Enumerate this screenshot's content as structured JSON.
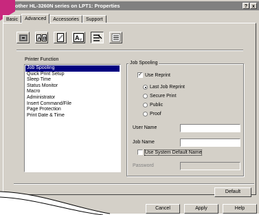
{
  "window": {
    "title": "other HL-3260N series on LPT1: Properties",
    "help_btn": "?",
    "close_btn": "x"
  },
  "tabs": [
    {
      "label": "Basic"
    },
    {
      "label": "Advanced"
    },
    {
      "label": "Accessories"
    },
    {
      "label": "Support"
    }
  ],
  "toolbar_icons": [
    {
      "name": "quality-icon"
    },
    {
      "name": "duplex-icon"
    },
    {
      "name": "watermark-icon"
    },
    {
      "name": "page-setting-icon"
    },
    {
      "name": "device-options-icon"
    },
    {
      "name": "settings-list-icon"
    }
  ],
  "printer_function": {
    "label": "Printer Function",
    "items": [
      "Job Spooling",
      "Quick Print Setup",
      "Sleep Time",
      "Status Monitor",
      "Macro",
      "Administrator",
      "Insert Command/File",
      "Page Protection",
      "Print Date & Time"
    ],
    "selected": "Job Spooling"
  },
  "job_spooling": {
    "group_title": "Job Spooling",
    "use_reprint": "Use Reprint",
    "use_reprint_checked": "✓",
    "options": [
      "Last Job Reprint",
      "Secure Print",
      "Public",
      "Proof"
    ],
    "selected_option": "Last Job Reprint",
    "user_name_label": "User Name",
    "user_name_value": "",
    "job_name_label": "Job Name",
    "job_name_value": "",
    "use_system_default": "Use System Default Name",
    "password_label": "Password",
    "password_value": ""
  },
  "buttons": {
    "default": "Default",
    "cancel": "Cancel",
    "apply": "Apply",
    "help": "Help"
  }
}
